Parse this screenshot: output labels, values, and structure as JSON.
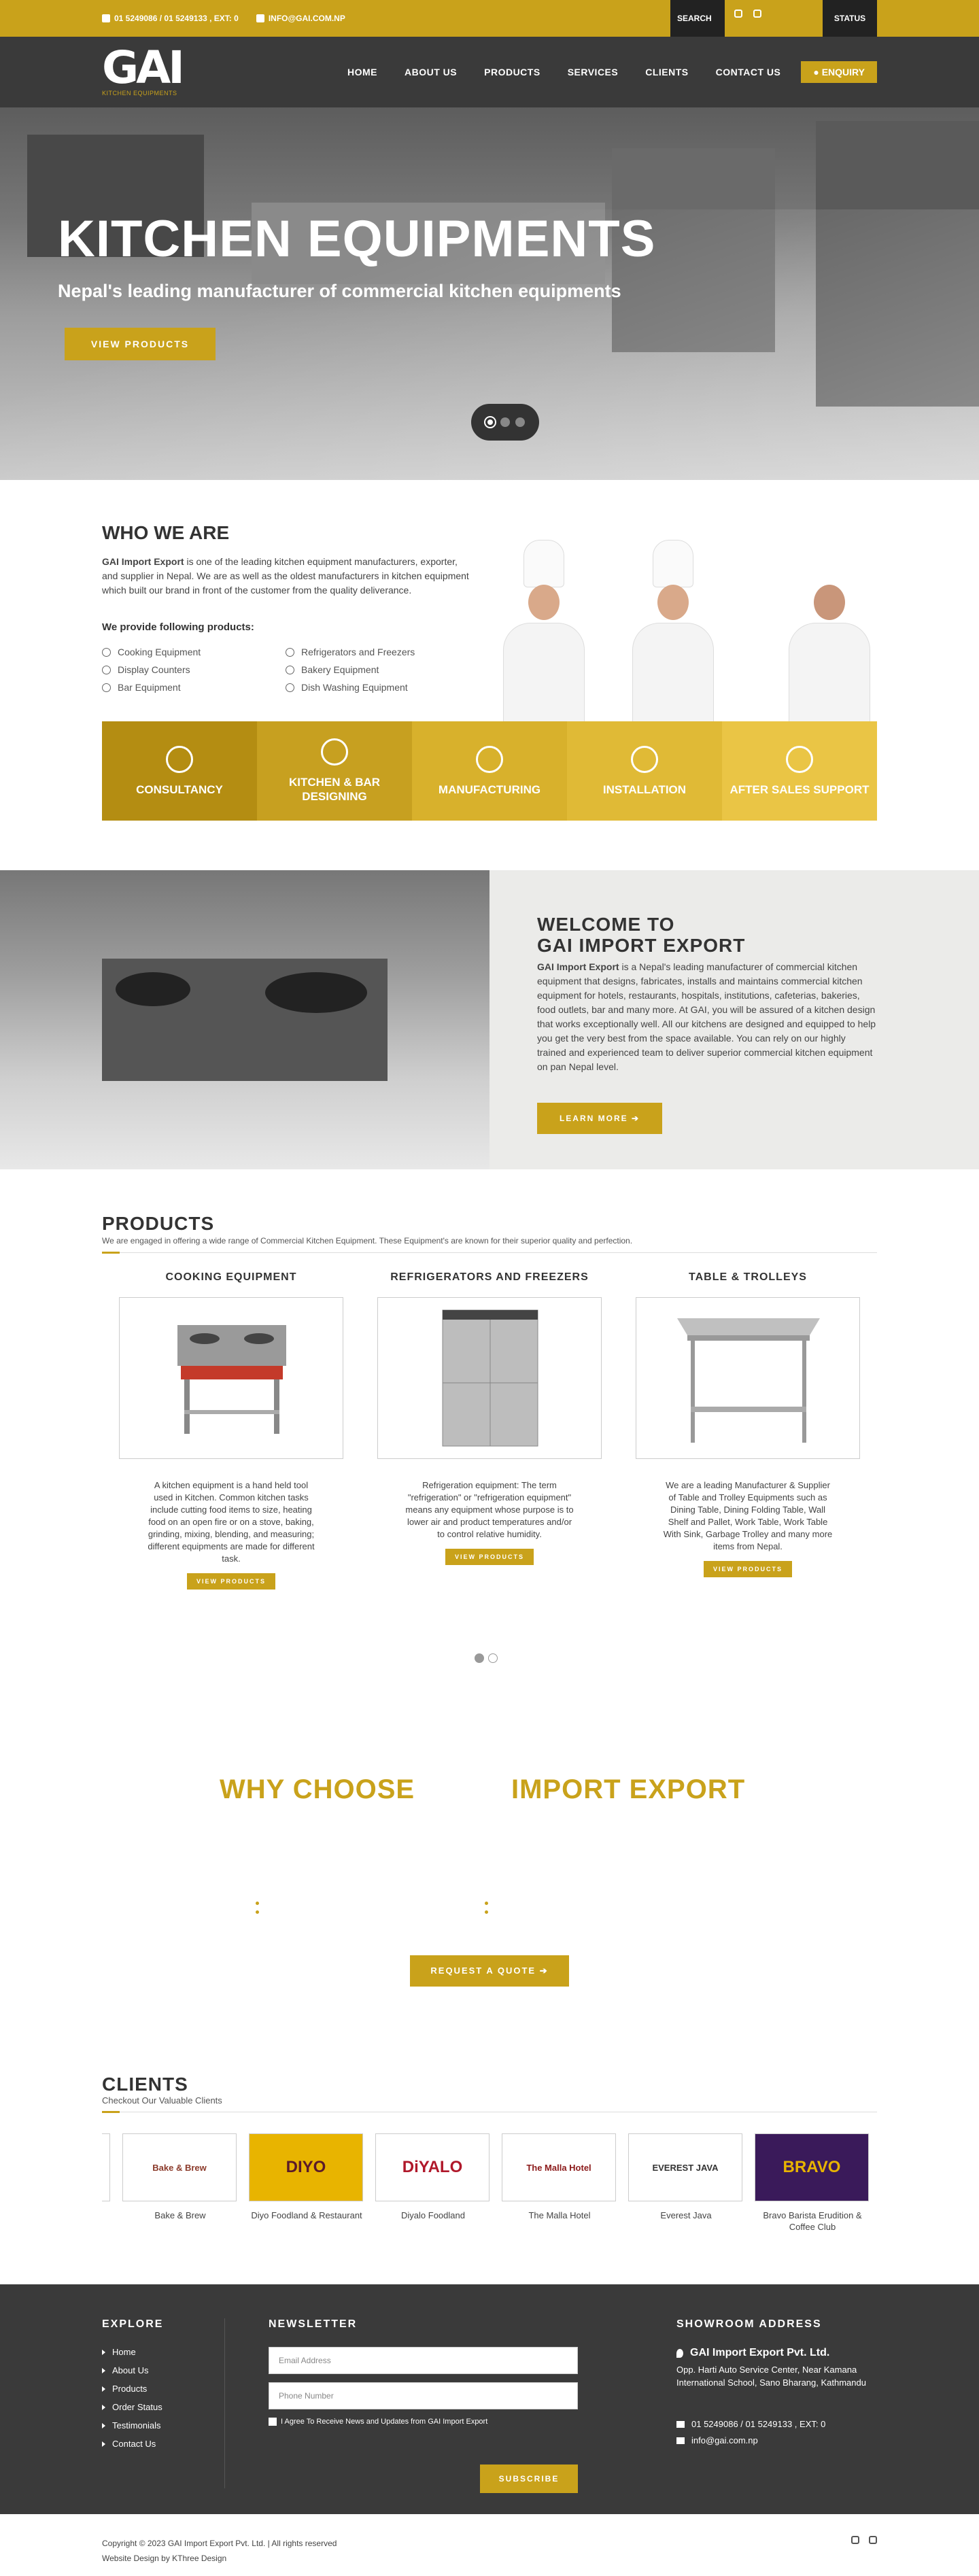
{
  "topbar": {
    "phone": "01 5249086 / 01 5249133 , EXT: 0",
    "email": "INFO@GAI.COM.NP",
    "search_label": "SEARCH",
    "status_label": "STATUS"
  },
  "nav": {
    "logo_text": "GAI",
    "logo_sub": "KITCHEN EQUIPMENTS",
    "items": [
      "HOME",
      "ABOUT US",
      "PRODUCTS",
      "SERVICES",
      "CLIENTS",
      "CONTACT US"
    ],
    "enquiry": "ENQUIRY"
  },
  "hero": {
    "title": "KITCHEN EQUIPMENTS",
    "subtitle": "Nepal's leading manufacturer of commercial kitchen equipments",
    "button": "VIEW PRODUCTS"
  },
  "who": {
    "title": "WHO WE ARE",
    "intro_bold": "GAI Import Export",
    "intro_rest": " is one of the leading kitchen equipment manufacturers, exporter, and supplier in Nepal. We are as well as the oldest manufacturers in kitchen equipment which built our brand in front of the customer from the quality deliverance.",
    "sub": "We provide following products:",
    "products": [
      "Cooking Equipment",
      "Refrigerators and Freezers",
      "Display Counters",
      "Bakery Equipment",
      "Bar Equipment",
      "Dish Washing Equipment"
    ]
  },
  "services": [
    {
      "label": "CONSULTANCY",
      "color": "#b48d12"
    },
    {
      "label": "KITCHEN & BAR DESIGNING",
      "color": "#c7a020"
    },
    {
      "label": "MANUFACTURING",
      "color": "#d8b12c"
    },
    {
      "label": "INSTALLATION",
      "color": "#e0ba36"
    },
    {
      "label": "AFTER SALES SUPPORT",
      "color": "#eac545"
    }
  ],
  "welcome": {
    "title_line1": "WELCOME TO",
    "title_line2": "GAI IMPORT EXPORT",
    "body_bold": "GAI Import Export",
    "body_rest": " is a Nepal's leading manufacturer of commercial kitchen equipment that designs, fabricates, installs and maintains commercial kitchen equipment for hotels, restaurants, hospitals, institutions, cafeterias, bakeries, food outlets, bar and many more. At GAI, you will be assured of a kitchen design that works exceptionally well. All our kitchens are designed and equipped to help you get the very best from the space available. You can rely on our highly trained and experienced team to deliver superior commercial kitchen equipment on pan Nepal level.",
    "button": "LEARN MORE ➔"
  },
  "products": {
    "title": "PRODUCTS",
    "desc": "We are engaged in offering a wide range of Commercial Kitchen Equipment. These Equipment's are known for their superior quality and perfection.",
    "items": [
      {
        "title": "COOKING EQUIPMENT",
        "text": "A kitchen equipment is a hand held tool used in Kitchen. Common kitchen tasks include cutting food items to size, heating food on an open fire or on a stove, baking, grinding, mixing, blending, and measuring; different equipments are made for different task.",
        "button": "VIEW PRODUCTS"
      },
      {
        "title": "REFRIGERATORS AND FREEZERS",
        "text": "Refrigeration equipment: The term \"refrigeration\" or \"refrigeration equipment\" means any equipment whose purpose is to lower air and product temperatures and/or to control relative humidity.",
        "button": "VIEW PRODUCTS"
      },
      {
        "title": "TABLE & TROLLEYS",
        "text": "We are a leading Manufacturer & Supplier of Table and Trolley Equipments such as Dining Table, Dining Folding Table, Wall Shelf and Pallet, Work Table, Work Table With Sink, Garbage Trolley and many more items from Nepal.",
        "button": "VIEW PRODUCTS"
      }
    ]
  },
  "why": {
    "left": "WHY CHOOSE",
    "right": "IMPORT EXPORT",
    "button": "REQUEST A QUOTE ➔"
  },
  "clients": {
    "title": "CLIENTS",
    "desc": "Checkout Our Valuable Clients",
    "items": [
      {
        "name": "Bake & Brew",
        "logo": "Bake & Brew",
        "bg": "#ffffff",
        "fg": "#8b3a2a"
      },
      {
        "name": "Diyo Foodland & Restaurant",
        "logo": "DIYO",
        "bg": "#e8b400",
        "fg": "#5a1a2a"
      },
      {
        "name": "Diyalo Foodland",
        "logo": "DiYALO",
        "bg": "#ffffff",
        "fg": "#b0182a"
      },
      {
        "name": "The Malla Hotel",
        "logo": "The Malla Hotel",
        "bg": "#ffffff",
        "fg": "#8b1a1a"
      },
      {
        "name": "Everest Java",
        "logo": "EVEREST JAVA",
        "bg": "#ffffff",
        "fg": "#333333"
      },
      {
        "name": "Bravo Barista Erudition & Coffee Club",
        "logo": "BRAVO",
        "bg": "#3a1a5a",
        "fg": "#e8b400"
      }
    ]
  },
  "footer": {
    "explore_title": "EXPLORE",
    "explore": [
      "Home",
      "About Us",
      "Products",
      "Order Status",
      "Testimonials",
      "Contact Us"
    ],
    "newsletter_title": "NEWSLETTER",
    "email_placeholder": "Email Address",
    "phone_placeholder": "Phone Number",
    "agree": "I Agree To Receive News and Updates from GAI Import Export",
    "subscribe": "SUBSCRIBE",
    "showroom_title": "SHOWROOM ADDRESS",
    "company": "GAI Import Export Pvt. Ltd.",
    "address": "Opp. Harti Auto Service Center, Near Kamana International School, Sano Bharang, Kathmandu",
    "phone": "01 5249086 / 01 5249133 , EXT: 0",
    "email": "info@gai.com.np"
  },
  "bottom": {
    "copyright": "Copyright © 2023 GAI Import Export Pvt. Ltd. | All rights reserved",
    "design": "Website Design by KThree Design"
  }
}
